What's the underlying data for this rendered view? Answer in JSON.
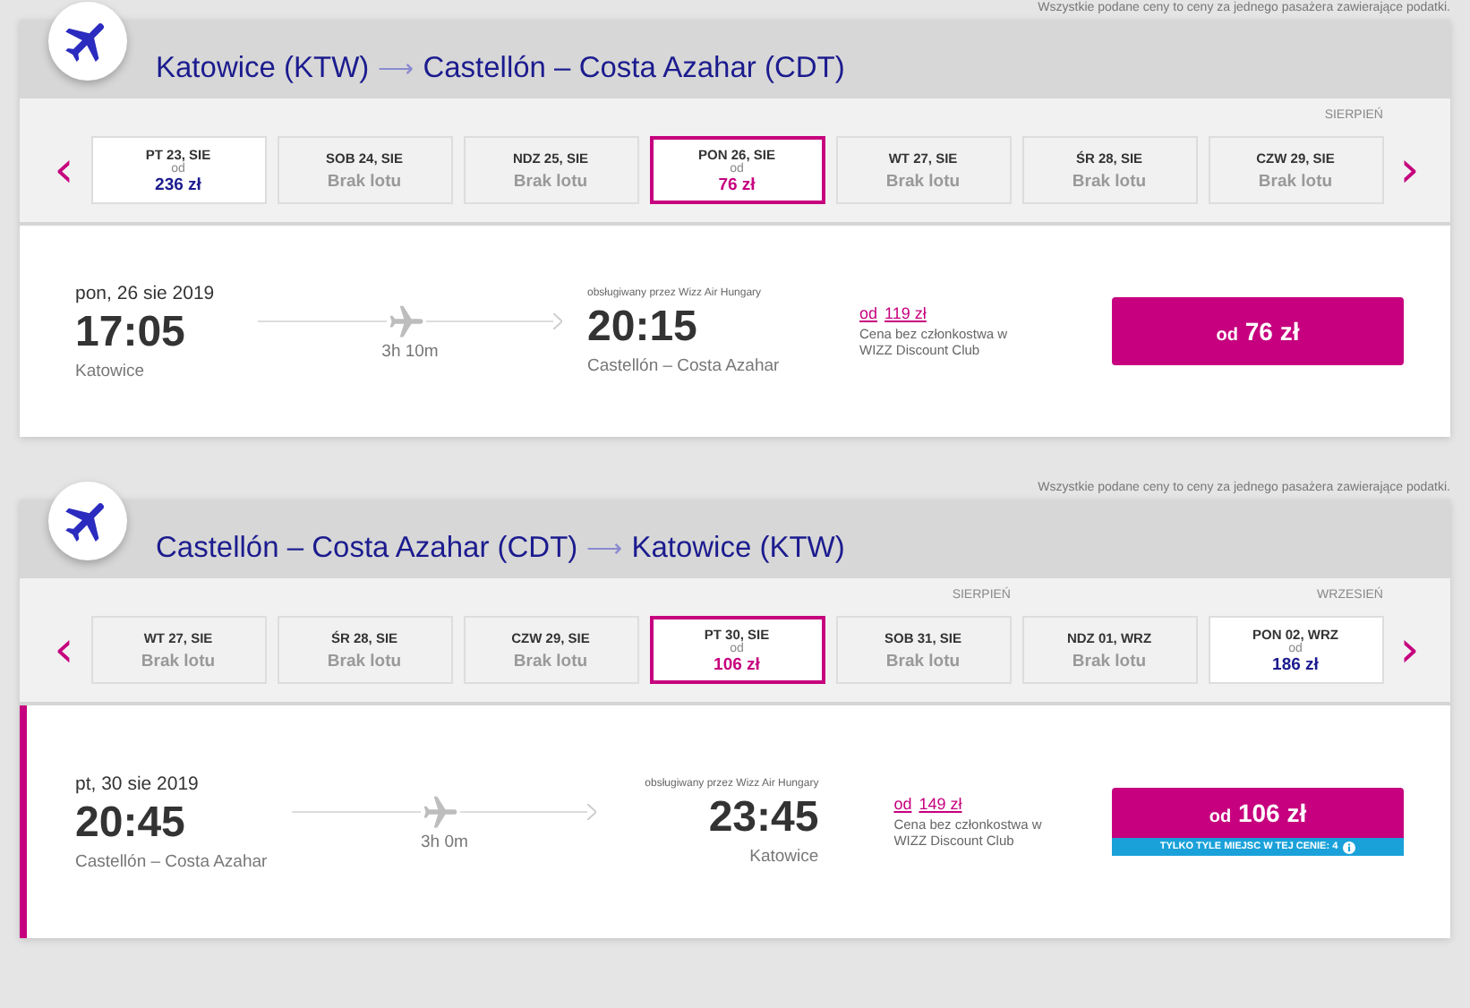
{
  "sections": [
    {
      "disclaimer": "Wszystkie podane ceny to ceny za jednego pasażera zawierające podatki.",
      "route": {
        "origin": "Katowice (KTW)",
        "arrow": "⟶",
        "destination": "Castellón – Costa Azahar (CDT)"
      },
      "prev": "‹",
      "next": "›",
      "dates": [
        {
          "day": "PT 23, SIE",
          "kind": "available",
          "note": "od",
          "price": "236 zł",
          "selected": false
        },
        {
          "day": "SOB 24, SIE",
          "kind": "unavailable",
          "price": "Brak lotu",
          "selected": false
        },
        {
          "day": "NDZ 25, SIE",
          "kind": "unavailable",
          "price": "Brak lotu",
          "selected": false
        },
        {
          "day": "PON 26, SIE",
          "kind": "available",
          "note": "od",
          "price": "76 zł",
          "selected": true
        },
        {
          "day": "WT 27, SIE",
          "kind": "unavailable",
          "price": "Brak lotu",
          "selected": false
        },
        {
          "day": "ŚR 28, SIE",
          "kind": "unavailable",
          "price": "Brak lotu",
          "selected": false
        },
        {
          "day": "CZW 29, SIE",
          "kind": "unavailable",
          "price": "Brak lotu",
          "selected": false,
          "month": "SIERPIEŃ"
        }
      ],
      "flight": {
        "selected": false,
        "date": "pon, 26 sie 2019",
        "depart_time": "17:05",
        "depart_city": "Katowice",
        "duration": "3h 10m",
        "operator": "obsługiwany przez Wizz Air Hungary",
        "arrive_time": "20:15",
        "arrive_city": "Castellón – Costa Azahar",
        "regular_prefix": "od",
        "regular_price": "119 zł",
        "regular_note": "Cena bez członkostwa w WIZZ Discount Club",
        "button_prefix": "od",
        "button_price": "76 zł"
      }
    },
    {
      "disclaimer": "Wszystkie podane ceny to ceny za jednego pasażera zawierające podatki.",
      "route": {
        "origin": "Castellón – Costa Azahar (CDT)",
        "arrow": "⟶",
        "destination": "Katowice (KTW)"
      },
      "prev": "‹",
      "next": "›",
      "dates": [
        {
          "day": "WT 27, SIE",
          "kind": "unavailable",
          "price": "Brak lotu",
          "selected": false
        },
        {
          "day": "ŚR 28, SIE",
          "kind": "unavailable",
          "price": "Brak lotu",
          "selected": false
        },
        {
          "day": "CZW 29, SIE",
          "kind": "unavailable",
          "price": "Brak lotu",
          "selected": false
        },
        {
          "day": "PT 30, SIE",
          "kind": "available",
          "note": "od",
          "price": "106 zł",
          "selected": true
        },
        {
          "day": "SOB 31, SIE",
          "kind": "unavailable",
          "price": "Brak lotu",
          "selected": false,
          "month": "SIERPIEŃ"
        },
        {
          "day": "NDZ 01, WRZ",
          "kind": "unavailable",
          "price": "Brak lotu",
          "selected": false
        },
        {
          "day": "PON 02, WRZ",
          "kind": "available",
          "note": "od",
          "price": "186 zł",
          "selected": false,
          "month": "WRZESIEŃ"
        }
      ],
      "flight": {
        "selected": true,
        "date": "pt, 30 sie 2019",
        "depart_time": "20:45",
        "depart_city": "Castellón – Costa Azahar",
        "duration": "3h 0m",
        "operator": "obsługiwany przez Wizz Air Hungary",
        "arrive_time": "23:45",
        "arrive_city": "Katowice",
        "regular_prefix": "od",
        "regular_price": "149 zł",
        "regular_note": "Cena bez członkostwa w WIZZ Discount Club",
        "button_prefix": "od",
        "button_price": "106 zł",
        "seats_notice": "TYLKO TYLE MIEJSC W TEJ CENIE: 4"
      }
    }
  ]
}
